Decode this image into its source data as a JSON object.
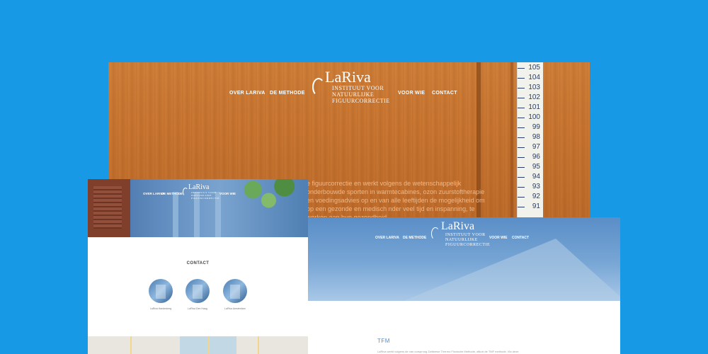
{
  "back_site": {
    "logo": {
      "name": "LaRiva",
      "tagline1": "INSTITUUT VOOR",
      "tagline2": "NATUURLIJKE",
      "tagline3": "FIGUURCORRECTIE"
    },
    "nav": [
      "OVER LARIVA",
      "DE METHODE",
      "VOOR WIE",
      "CONTACT"
    ],
    "ruler": [
      "105",
      "104",
      "103",
      "102",
      "101",
      "100",
      "99",
      "98",
      "97",
      "96",
      "95",
      "94",
      "93",
      "92",
      "91"
    ],
    "paragraph": "e figuurcorrectie en werkt volgens de wetenschappelijk onderbouwde sporten in warmtecabines, ozon zuurstoftherapie en voedingsadvies op en van alle leeftijden de mogelijkheid om op een gezonde en medisch nder veel tijd en inspanning, te werken aan hun gezondheid"
  },
  "left_site": {
    "logo": {
      "name": "LaRiva",
      "tagline1": "INSTITUUT VOOR",
      "tagline2": "NATUURLIJKE",
      "tagline3": "FIGUURCORRECTIE"
    },
    "nav": [
      "OVER LARIVA",
      "DE METHODE",
      "VOOR WIE"
    ],
    "contact_title": "CONTACT",
    "locations": [
      "LaRiva Hardenberg",
      "LaRiva Den Haag",
      "LaRiva Amsterdam"
    ]
  },
  "right_site": {
    "logo": {
      "name": "LaRiva",
      "tagline1": "INSTITUUT VOOR",
      "tagline2": "NATUURLIJKE",
      "tagline3": "FIGUURCORRECTIE"
    },
    "nav": [
      "OVER LARIVA",
      "DE METHODE",
      "VOOR WIE",
      "CONTACT"
    ],
    "section_title": "TFM",
    "intro": "LaRiva werkt volgens de van oorsprong Zwitserse Thermo Fluxische Methode, afkort de TMF methode. Via deze"
  },
  "colors": {
    "background": "#1799e6",
    "wood": "#c8732d",
    "accent_blue": "#5a8ec7"
  }
}
